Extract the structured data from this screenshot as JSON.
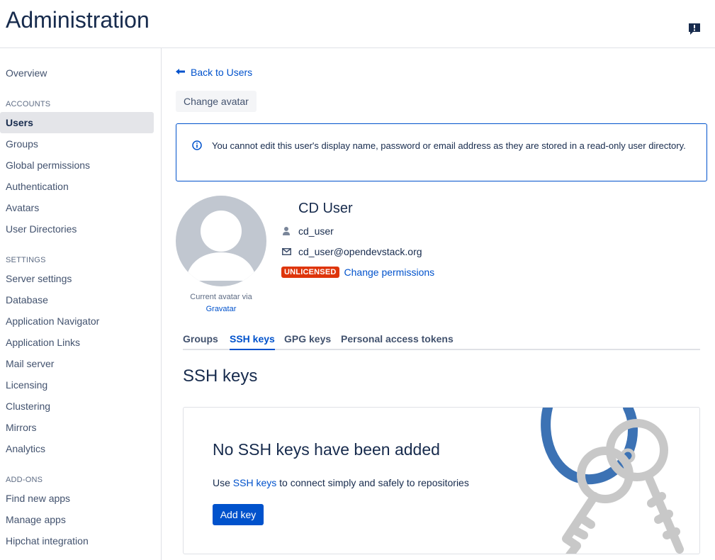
{
  "header": {
    "title": "Administration"
  },
  "sidebar": {
    "overview": "Overview",
    "sections": {
      "accounts": "ACCOUNTS",
      "settings": "SETTINGS",
      "addons": "ADD-ONS"
    },
    "accounts_items": [
      "Users",
      "Groups",
      "Global permissions",
      "Authentication",
      "Avatars",
      "User Directories"
    ],
    "settings_items": [
      "Server settings",
      "Database",
      "Application Navigator",
      "Application Links",
      "Mail server",
      "Licensing",
      "Clustering",
      "Mirrors",
      "Analytics"
    ],
    "addons_items": [
      "Find new apps",
      "Manage apps",
      "Hipchat integration"
    ],
    "active_item": "Users"
  },
  "main": {
    "back_link": "Back to Users",
    "change_avatar": "Change avatar",
    "info_message": "You cannot edit this user's display name, password or email address as they are stored in a read-only user directory.",
    "avatar_caption": "Current avatar via",
    "avatar_source": "Gravatar",
    "user": {
      "display_name": "CD User",
      "username": "cd_user",
      "email": "cd_user@opendevstack.org",
      "license_badge": "UNLICENSED",
      "change_permissions": "Change permissions"
    },
    "tabs": [
      "Groups",
      "SSH keys",
      "GPG keys",
      "Personal access tokens"
    ],
    "active_tab": "SSH keys",
    "section_title": "SSH keys",
    "empty_state": {
      "title": "No SSH keys have been added",
      "desc_prefix": "Use",
      "desc_link": "SSH keys",
      "desc_suffix": "to connect simply and safely to repositories",
      "button": "Add key"
    }
  },
  "colors": {
    "link": "#0052cc",
    "badge": "#de350b",
    "text": "#172b4d",
    "avatar_bg": "#c1c7d0",
    "illustration_ring": "#3c72b4",
    "illustration_keys": "#c8c8c8"
  },
  "icons": [
    "feedback-icon",
    "back-arrow-icon",
    "info-icon",
    "user-icon",
    "envelope-icon",
    "keys-illustration"
  ]
}
